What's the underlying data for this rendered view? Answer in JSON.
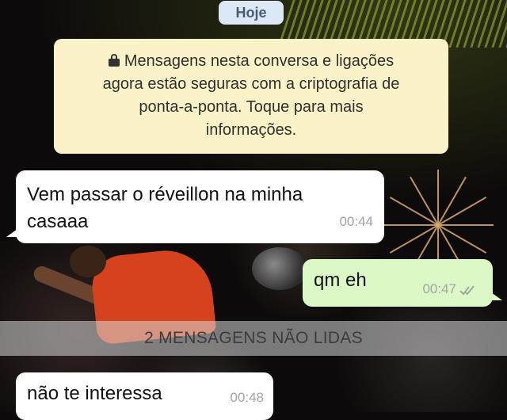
{
  "chat": {
    "date_label": "Hoje",
    "encryption_notice": {
      "line1": "Mensagens nesta conversa e ligações",
      "line2": "agora estão seguras com a criptografia de",
      "line3": "ponta-a-ponta. Toque para mais",
      "line4": "informações."
    },
    "messages": [
      {
        "direction": "incoming",
        "text_line1": "Vem passar o réveillon na minha",
        "text_line2": "casaaa",
        "time": "00:44"
      },
      {
        "direction": "outgoing",
        "text": "qm eh",
        "time": "00:47",
        "status_icon": "double-check-icon"
      },
      {
        "direction": "incoming",
        "text": "não te interessa",
        "time": "00:48"
      }
    ],
    "unread_divider": "2 MENSAGENS NÃO LIDAS"
  },
  "colors": {
    "incoming_bubble": "#ffffff",
    "outgoing_bubble": "#dcf8c6",
    "notice_bg": "#fbf3c7",
    "date_pill_bg": "#dde8f7"
  }
}
